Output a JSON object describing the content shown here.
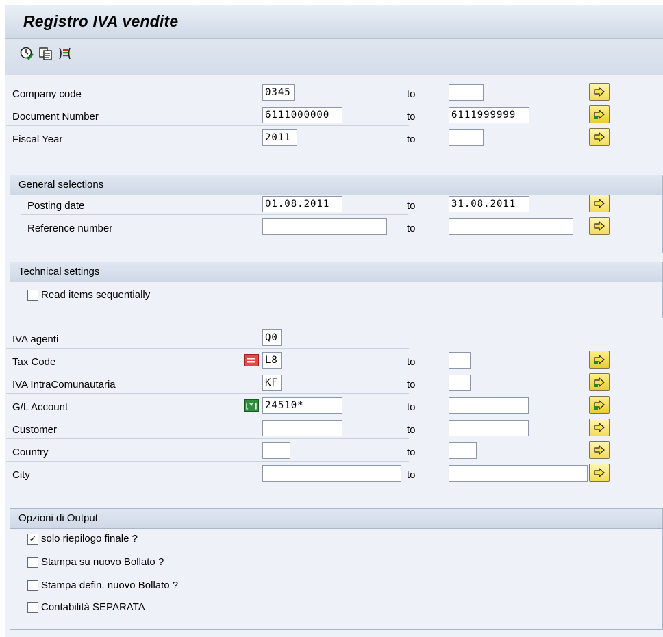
{
  "window": {
    "title": "Registro IVA vendite"
  },
  "toolbar": {
    "icons": [
      "execute-icon",
      "get-variant-icon",
      "selection-options-icon"
    ]
  },
  "main": {
    "to_label": "to",
    "rows": [
      {
        "label": "Company code",
        "low": "0345",
        "high": ""
      },
      {
        "label": "Document Number",
        "low": "6111000000",
        "high": "6111999999"
      },
      {
        "label": "Fiscal Year",
        "low": "2011",
        "high": ""
      }
    ]
  },
  "general_selections": {
    "title": "General selections",
    "rows": [
      {
        "label": "Posting date",
        "low": "01.08.2011",
        "high": "31.08.2011"
      },
      {
        "label": "Reference number",
        "low": "",
        "high": ""
      }
    ]
  },
  "technical_settings": {
    "title": "Technical settings",
    "read_items_sequentially": {
      "label": "Read items sequentially",
      "checked": false
    }
  },
  "params": {
    "iva_agenti": {
      "label": "IVA agenti",
      "value": "Q0"
    },
    "rows": [
      {
        "label": "Tax Code",
        "low": "L8",
        "high": "",
        "option": "equals"
      },
      {
        "label": "IVA IntraComunautaria",
        "low": "KF",
        "high": ""
      },
      {
        "label": "G/L Account",
        "low": "24510*",
        "high": "",
        "option": "pattern"
      },
      {
        "label": "Customer",
        "low": "",
        "high": ""
      },
      {
        "label": "Country",
        "low": "",
        "high": ""
      },
      {
        "label": "City",
        "low": "",
        "high": ""
      }
    ]
  },
  "output_options": {
    "title": "Opzioni di Output",
    "items": [
      {
        "label": "solo riepilogo finale ?",
        "checked": true,
        "mark": "✓"
      },
      {
        "label": "Stampa su nuovo Bollato ?",
        "checked": false,
        "mark": ""
      },
      {
        "label": "Stampa defin. nuovo Bollato ?",
        "checked": false,
        "mark": ""
      },
      {
        "label": "Contabilità SEPARATA",
        "checked": false,
        "mark": ""
      }
    ]
  },
  "colors": {
    "accent": "#f2dc5a",
    "frame": "#eef2f8",
    "header": "#cfd9e6"
  }
}
